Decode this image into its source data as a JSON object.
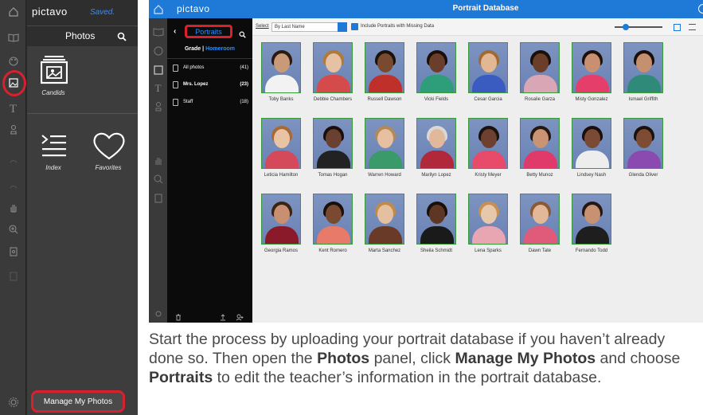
{
  "left": {
    "logo": "pictavo",
    "saved": "Saved.",
    "panel_title": "Photos",
    "items": [
      {
        "label": "Candids",
        "icon": "candids-icon"
      },
      {
        "label": "Index",
        "icon": "index-icon"
      },
      {
        "label": "Favorites",
        "icon": "heart-icon"
      }
    ],
    "manage_button": "Manage My Photos"
  },
  "right": {
    "logo": "pictavo",
    "title": "Portrait Database",
    "portraits_button": "Portraits",
    "grade": "Grade",
    "separator": "|",
    "homeroom": "Homeroom",
    "groups": [
      {
        "label": "All photos",
        "count": "(41)"
      },
      {
        "label": "Mrs. Lopez",
        "count": "(23)"
      },
      {
        "label": "Staff",
        "count": "(18)"
      }
    ],
    "select_label": "Select",
    "sort_value": "By Last Name",
    "missing_data_label": "Include Portraits with Missing Data",
    "portraits": [
      {
        "name": "Toby Banks",
        "skin": "#c99a78",
        "hair": "#2a1a10",
        "shirt": "#f2f2f2"
      },
      {
        "name": "Debbie Chambers",
        "skin": "#e6c2a4",
        "hair": "#b07a3a",
        "shirt": "#d54a4a"
      },
      {
        "name": "Russell Dawson",
        "skin": "#7a4a30",
        "hair": "#1c120c",
        "shirt": "#c0302a"
      },
      {
        "name": "Vicki Fields",
        "skin": "#6a3e2a",
        "hair": "#1a0f0a",
        "shirt": "#2e9e7a"
      },
      {
        "name": "Cesar Garcia",
        "skin": "#e2b894",
        "hair": "#a06a34",
        "shirt": "#3a5cc0"
      },
      {
        "name": "Rosalie Garza",
        "skin": "#6a3e28",
        "hair": "#1a100a",
        "shirt": "#d9a6b6"
      },
      {
        "name": "Misty Gonzalez",
        "skin": "#c89070",
        "hair": "#1c120c",
        "shirt": "#e63e6a"
      },
      {
        "name": "Ismael Griffith",
        "skin": "#c49070",
        "hair": "#1a0f0a",
        "shirt": "#2f8a7a"
      },
      {
        "name": "Leticia Hamilton",
        "skin": "#e8c4a4",
        "hair": "#a86a34",
        "shirt": "#d44a5a"
      },
      {
        "name": "Tomas Hogan",
        "skin": "#6a4030",
        "hair": "#1a0f0a",
        "shirt": "#222222"
      },
      {
        "name": "Warren Howard",
        "skin": "#e6c0a0",
        "hair": "#b08a58",
        "shirt": "#3a9a6a"
      },
      {
        "name": "Marilyn Lopez",
        "skin": "#e2b89a",
        "hair": "#d8d8d8",
        "shirt": "#b0283a"
      },
      {
        "name": "Kristy Meyer",
        "skin": "#6e4030",
        "hair": "#1c120c",
        "shirt": "#e84a6a"
      },
      {
        "name": "Betty Munoz",
        "skin": "#c89474",
        "hair": "#241810",
        "shirt": "#e03a6a"
      },
      {
        "name": "Lindsey Nash",
        "skin": "#7a4a34",
        "hair": "#1a0f0a",
        "shirt": "#ededed"
      },
      {
        "name": "Glenda Oliver",
        "skin": "#7e4c34",
        "hair": "#1c120c",
        "shirt": "#8a4ab0"
      },
      {
        "name": "Georgia Ramos",
        "skin": "#c89070",
        "hair": "#3a2414",
        "shirt": "#8a1a2a"
      },
      {
        "name": "Kent Romero",
        "skin": "#7a4a30",
        "hair": "#1a0f0a",
        "shirt": "#e87a6a"
      },
      {
        "name": "Marta Sanchez",
        "skin": "#e4c0a0",
        "hair": "#c08a48",
        "shirt": "#6a3a28"
      },
      {
        "name": "Sheila Schmidt",
        "skin": "#5e3624",
        "hair": "#1a0f0a",
        "shirt": "#1a1a1a"
      },
      {
        "name": "Lena Sparks",
        "skin": "#e8c8aa",
        "hair": "#c89050",
        "shirt": "#e8a6b2"
      },
      {
        "name": "Dawn Tate",
        "skin": "#e2b898",
        "hair": "#8a5a34",
        "shirt": "#e05a7a"
      },
      {
        "name": "Fernando Todd",
        "skin": "#c89272",
        "hair": "#241810",
        "shirt": "#1e1e1e"
      }
    ]
  },
  "caption": {
    "p1": "Start the process by uploading your portrait database if you haven’t already done so. Then open the ",
    "b1": "Photos",
    "p2": " panel, click ",
    "b2": "Manage My Photos",
    "p3": " and choose ",
    "b3": "Portraits",
    "p4": " to edit the teacher’s information in the portrait database."
  },
  "colors": {
    "accent": "#1e7ad6",
    "highlight": "#d9202f",
    "portrait_border": "#3a9a3a"
  }
}
